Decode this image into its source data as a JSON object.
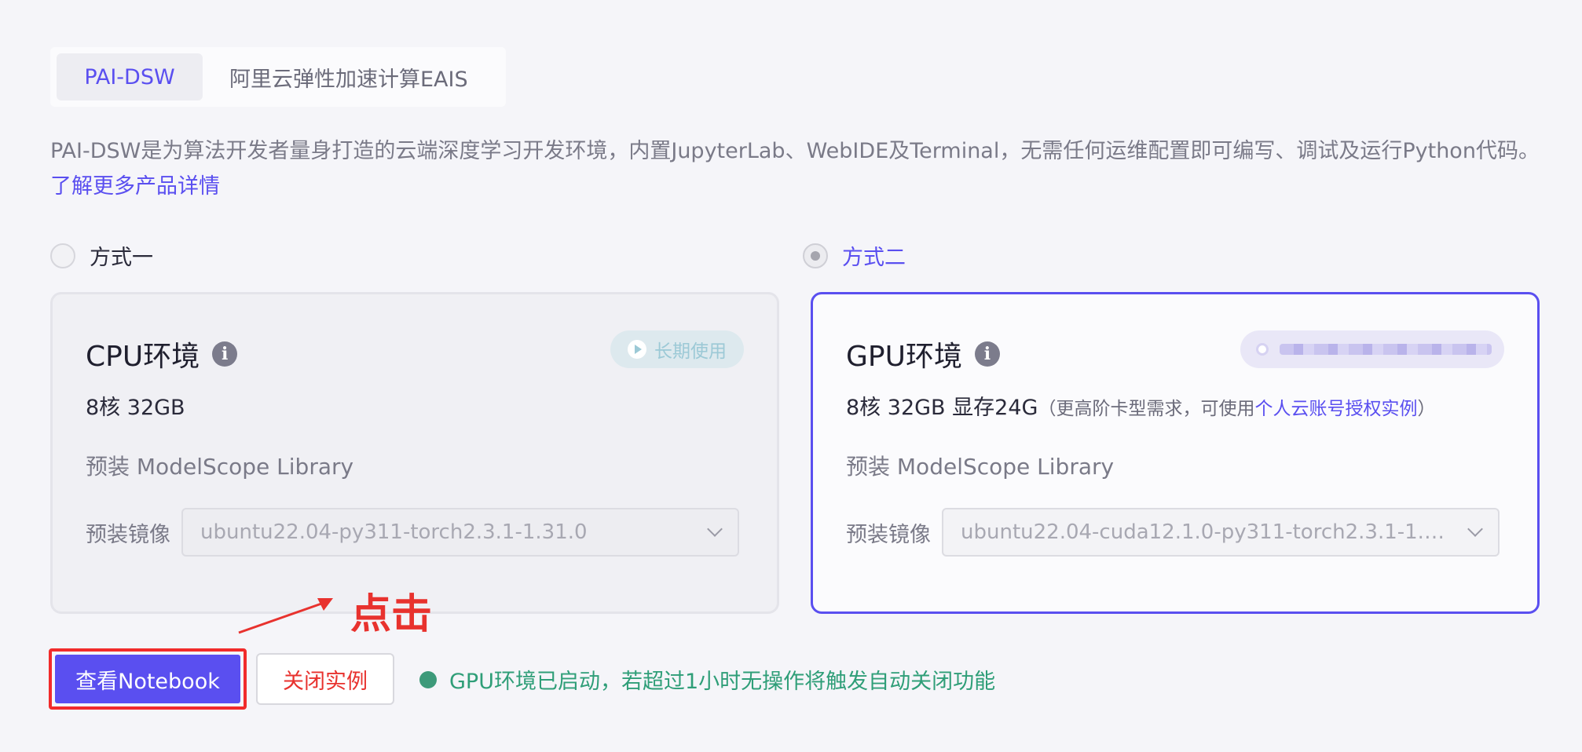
{
  "tabs": [
    {
      "label": "PAI-DSW",
      "active": true
    },
    {
      "label": "阿里云弹性加速计算EAIS",
      "active": false
    }
  ],
  "description": {
    "text": "PAI-DSW是为算法开发者量身打造的云端深度学习开发环境，内置JupyterLab、WebIDE及Terminal，无需任何运维配置即可编写、调试及运行Python代码。",
    "link_text": "了解更多产品详情"
  },
  "options": [
    {
      "label": "方式一",
      "checked": false
    },
    {
      "label": "方式二",
      "checked": true
    }
  ],
  "cpu_card": {
    "title": "CPU环境",
    "badge": "长期使用",
    "spec": "8核 32GB",
    "preinstall": "预装 ModelScope Library",
    "image_label": "预装镜像",
    "image_value": "ubuntu22.04-py311-torch2.3.1-1.31.0"
  },
  "gpu_card": {
    "title": "GPU环境",
    "spec": "8核 32GB 显存24G",
    "note_prefix": "（更高阶卡型需求，可使用",
    "note_link": "个人云账号授权实例",
    "note_suffix": "）",
    "preinstall": "预装 ModelScope Library",
    "image_label": "预装镜像",
    "image_value": "ubuntu22.04-cuda12.1.0-py311-torch2.3.1-1.31.0"
  },
  "annotation": {
    "text": "点击",
    "color": "#e8322e"
  },
  "actions": {
    "view_notebook": "查看Notebook",
    "close_instance": "关闭实例"
  },
  "status": {
    "text": "GPU环境已启动，若超过1小时无操作将触发自动关闭功能",
    "color": "#2f9e78"
  },
  "colors": {
    "accent": "#5a4ff0",
    "danger": "#e8322e",
    "background": "#f5f5f9"
  }
}
